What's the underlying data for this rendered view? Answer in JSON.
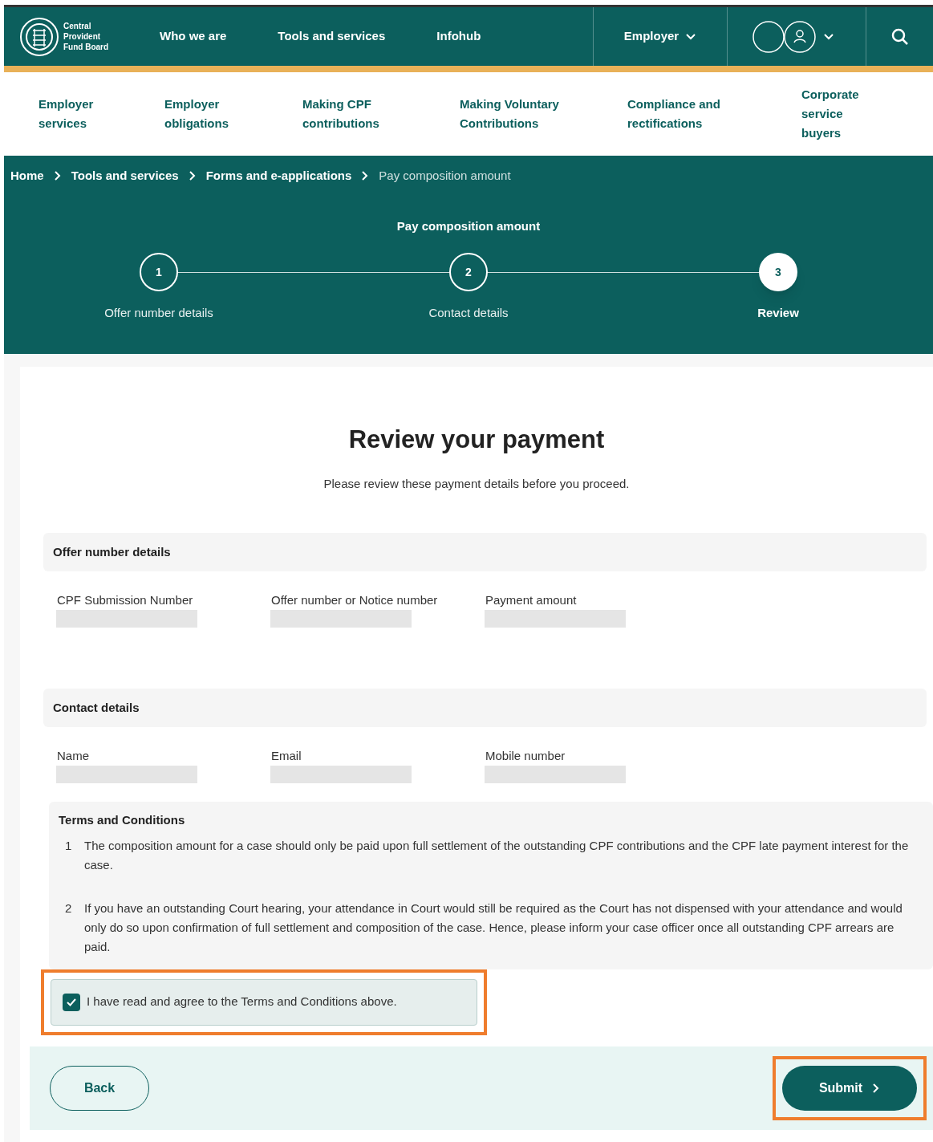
{
  "logo": {
    "lines": [
      "Central",
      "Provident",
      "Fund Board"
    ]
  },
  "top_nav": [
    {
      "label": "Who we are"
    },
    {
      "label": "Tools and services"
    },
    {
      "label": "Infohub"
    }
  ],
  "audience_menu": {
    "label": "Employer"
  },
  "sub_nav": [
    {
      "label": "Employer services"
    },
    {
      "label": "Employer obligations"
    },
    {
      "label": "Making CPF contributions"
    },
    {
      "label": "Making Voluntary Contributions"
    },
    {
      "label": "Compliance and rectifications"
    },
    {
      "label": "Corporate service buyers"
    }
  ],
  "breadcrumbs": [
    {
      "label": "Home",
      "current": false
    },
    {
      "label": "Tools and services",
      "current": false
    },
    {
      "label": "Forms and e-applications",
      "current": false
    },
    {
      "label": "Pay composition amount",
      "current": true
    }
  ],
  "form_title": "Pay composition amount",
  "steps": [
    {
      "number": "1",
      "label": "Offer number details",
      "selected": false
    },
    {
      "number": "2",
      "label": "Contact details",
      "selected": false
    },
    {
      "number": "3",
      "label": "Review",
      "selected": true
    }
  ],
  "heading": "Review your payment",
  "intro": "Please review these payment details before you proceed.",
  "sections": [
    {
      "title": "Offer number details",
      "fields": [
        {
          "label": "CPF Submission Number"
        },
        {
          "label": "Offer number or Notice number"
        },
        {
          "label": "Payment amount"
        }
      ]
    },
    {
      "title": "Contact details",
      "fields": [
        {
          "label": "Name"
        },
        {
          "label": "Email"
        },
        {
          "label": "Mobile number"
        }
      ]
    }
  ],
  "terms": {
    "title": "Terms and Conditions",
    "items": [
      {
        "number": "1",
        "text": "The composition amount for a case should only be paid upon full settlement of the outstanding CPF contributions and the CPF late payment interest for the case."
      },
      {
        "number": "2",
        "text": "If you have an outstanding Court hearing, your attendance in Court would still be required as the Court has not dispensed with your attendance and would only do so upon confirmation of full settlement and composition of the case. Hence, please inform your case officer once all outstanding CPF arrears are paid."
      }
    ]
  },
  "agree": {
    "label": "I have read and agree to the Terms and Conditions above.",
    "checked": true,
    "highlighted": true
  },
  "back_button": {
    "label": "Back"
  },
  "submit_button": {
    "label": "Submit",
    "highlighted": true
  }
}
